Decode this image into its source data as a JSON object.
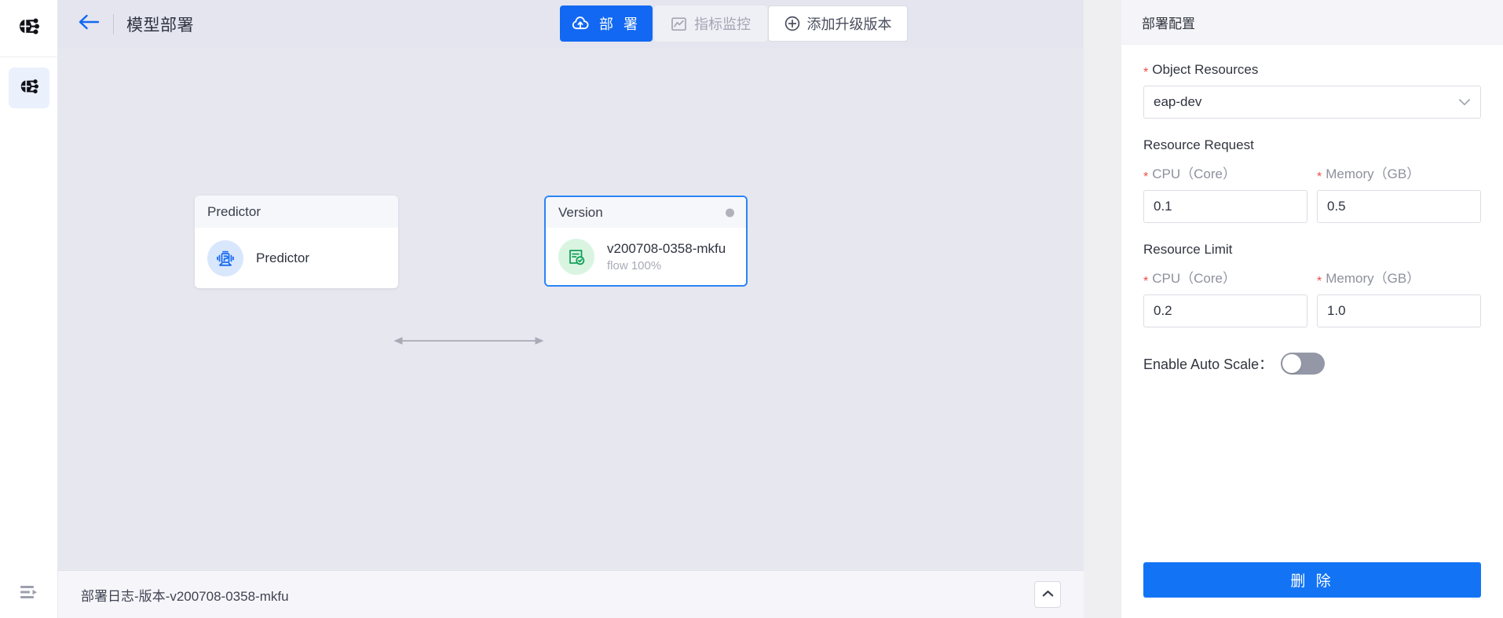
{
  "rail": {
    "logo_icon": "brain-circuit-logo",
    "items": [
      {
        "icon": "brain-circuit-icon",
        "name": "model-deploy",
        "active": true
      }
    ],
    "bottom_icon": "collapse-panel-icon"
  },
  "header": {
    "back_icon": "back-arrow-icon",
    "title": "模型部署",
    "actions": [
      {
        "name": "deploy-button",
        "label": "部 署",
        "icon": "cloud-upload-icon",
        "style": "primary",
        "disabled": false
      },
      {
        "name": "metrics-monitor-button",
        "label": "指标监控",
        "icon": "chart-monitor-icon",
        "style": "disabled",
        "disabled": true
      },
      {
        "name": "add-upgrade-version-button",
        "label": "添加升级版本",
        "icon": "plus-circle-icon",
        "style": "outline",
        "disabled": false
      }
    ]
  },
  "canvas": {
    "nodes": [
      {
        "name": "predictor-node",
        "header": "Predictor",
        "title": "Predictor",
        "subtitle": "",
        "icon": "predictor-icon",
        "selected": false,
        "has_status_dot": false
      },
      {
        "name": "version-node",
        "header": "Version",
        "title": "v200708-0358-mkfu",
        "subtitle": "flow 100%",
        "icon": "version-check-icon",
        "selected": true,
        "has_status_dot": true
      }
    ],
    "edge": {
      "name": "connector-edge",
      "type": "bidirectional-arrow"
    }
  },
  "logbar": {
    "text": "部署日志-版本-v200708-0358-mkfu",
    "toggle_icon": "chevron-up-icon"
  },
  "panel": {
    "title": "部署配置",
    "object_resources": {
      "label": "Object Resources",
      "required": true,
      "value": "eap-dev",
      "caret_icon": "chevron-down-icon"
    },
    "resource_request": {
      "section": "Resource Request",
      "cpu": {
        "label": "CPU（Core）",
        "required": true,
        "value": "0.1"
      },
      "memory": {
        "label": "Memory（GB）",
        "required": true,
        "value": "0.5"
      }
    },
    "resource_limit": {
      "section": "Resource Limit",
      "cpu": {
        "label": "CPU（Core）",
        "required": true,
        "value": "0.2"
      },
      "memory": {
        "label": "Memory（GB）",
        "required": true,
        "value": "1.0"
      }
    },
    "auto_scale": {
      "label": "Enable Auto Scale：",
      "enabled": false
    },
    "delete_button": "删 除"
  },
  "colors": {
    "primary": "#1268f3",
    "delete": "#1274f5",
    "selected_border": "#2a84f5",
    "required_star": "#f04b4b",
    "canvas_bg": "#e6e7ef",
    "node_icon_green": "#13a05a",
    "node_icon_blue": "#1a6cf0"
  }
}
